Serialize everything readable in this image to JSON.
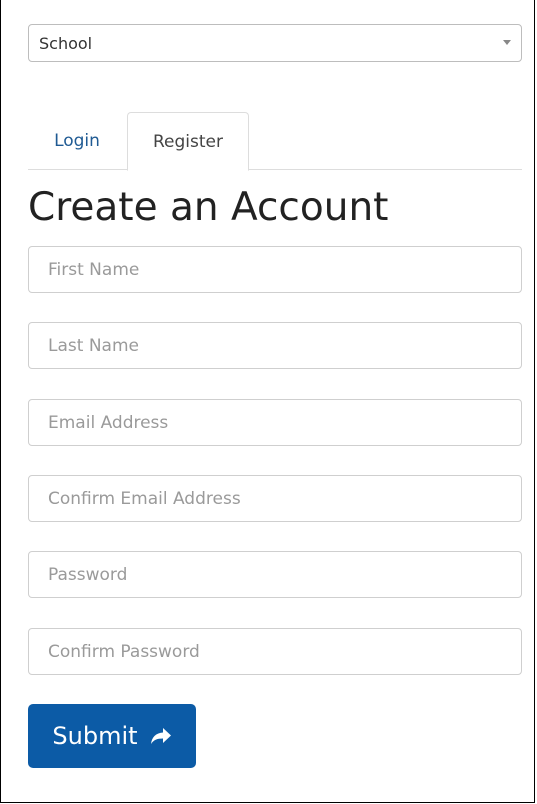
{
  "school_select": {
    "selected": "School"
  },
  "tabs": [
    {
      "label": "Login",
      "active": false
    },
    {
      "label": "Register",
      "active": true
    }
  ],
  "form": {
    "heading": "Create an Account",
    "fields": {
      "first_name": {
        "placeholder": "First Name",
        "value": ""
      },
      "last_name": {
        "placeholder": "Last Name",
        "value": ""
      },
      "email": {
        "placeholder": "Email Address",
        "value": ""
      },
      "confirm_email": {
        "placeholder": "Confirm Email Address",
        "value": ""
      },
      "password": {
        "placeholder": "Password",
        "value": ""
      },
      "confirm_password": {
        "placeholder": "Confirm Password",
        "value": ""
      }
    },
    "submit_label": "Submit",
    "submit_icon": "share-arrow-icon"
  },
  "colors": {
    "primary_button": "#0c5ba6",
    "link_tab": "#1f5a93",
    "border": "#cfcfcf"
  }
}
